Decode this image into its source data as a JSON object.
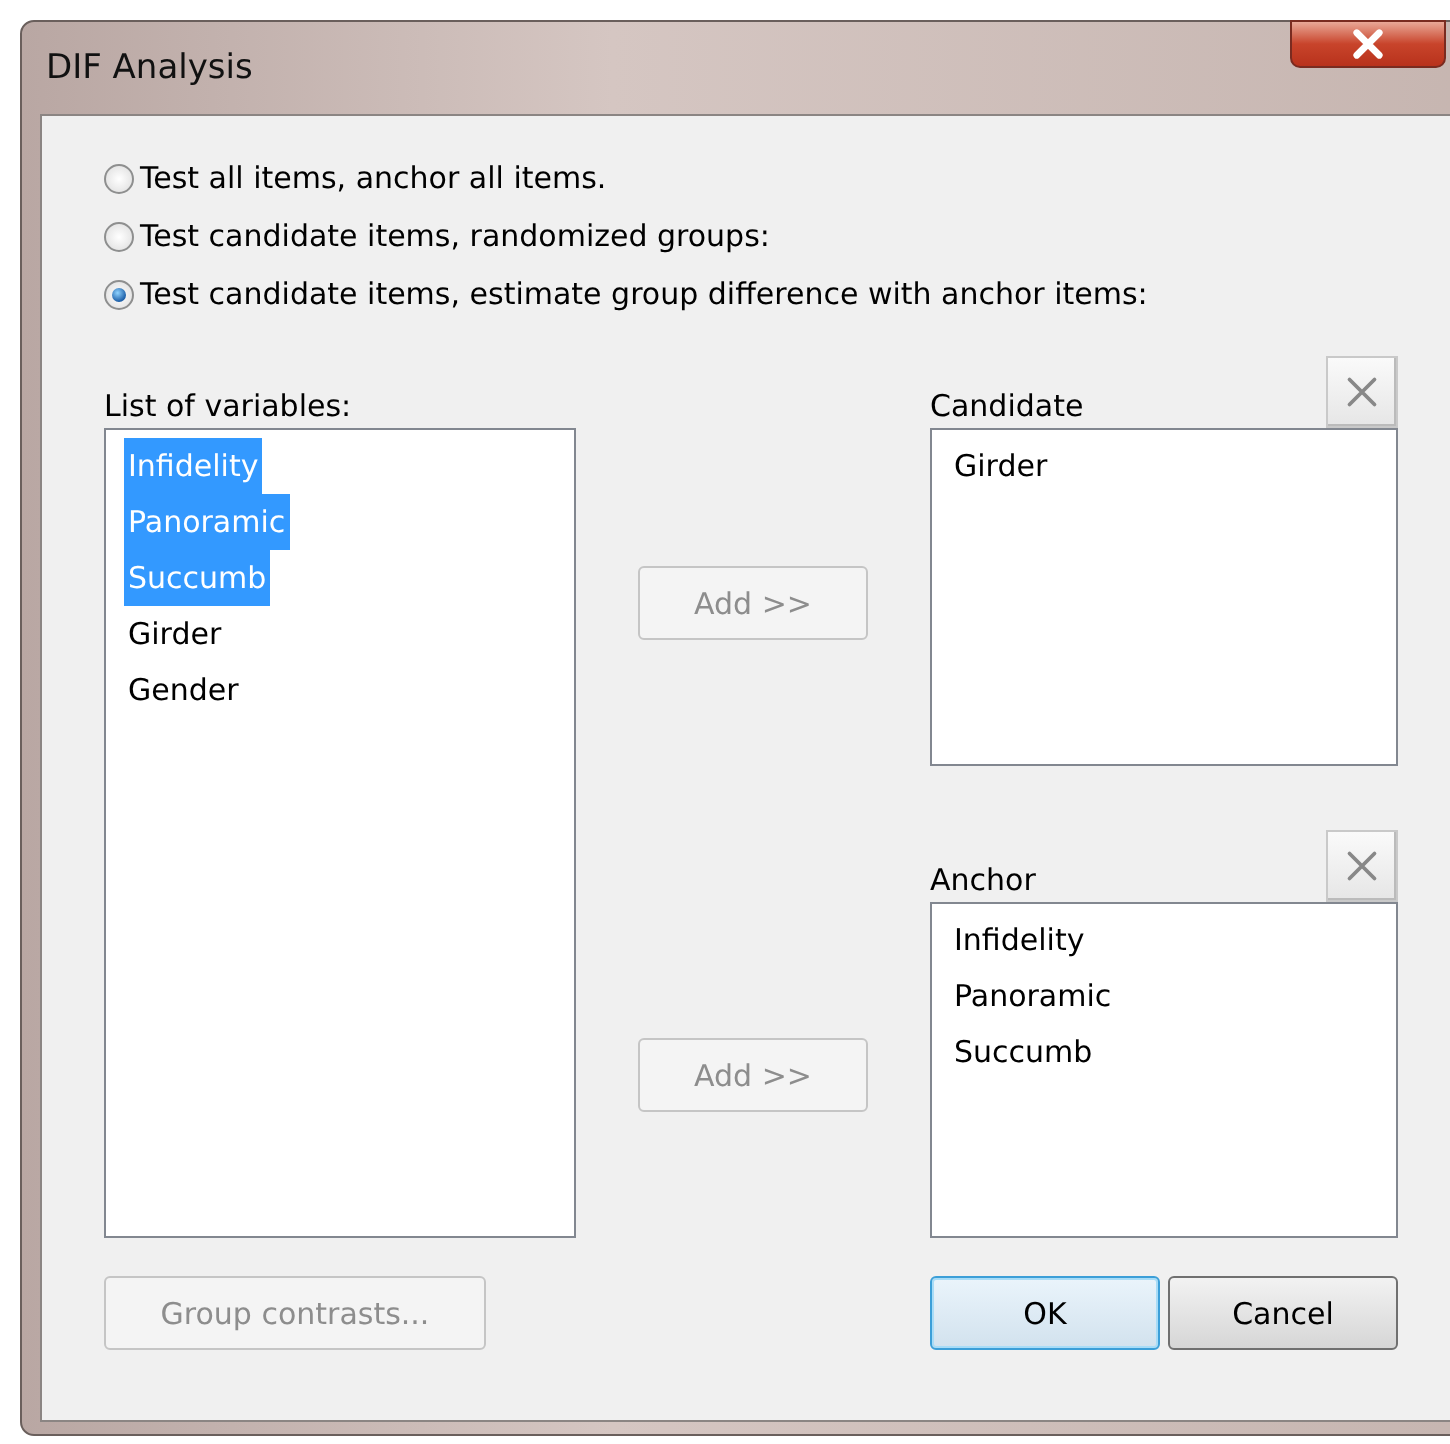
{
  "window": {
    "title": "DIF Analysis"
  },
  "options": [
    {
      "label": "Test all items, anchor all items.",
      "selected": false
    },
    {
      "label": "Test candidate items, randomized groups:",
      "selected": false
    },
    {
      "label": "Test candidate items, estimate group difference with anchor items:",
      "selected": true
    }
  ],
  "variables": {
    "label": "List of variables:",
    "items": [
      {
        "label": "Infidelity",
        "selected": true
      },
      {
        "label": "Panoramic",
        "selected": true
      },
      {
        "label": "Succumb",
        "selected": true
      },
      {
        "label": "Girder",
        "selected": false
      },
      {
        "label": "Gender",
        "selected": false
      }
    ]
  },
  "candidate": {
    "label": "Candidate",
    "add_button": {
      "label": "Add >>",
      "disabled": true
    },
    "items": [
      {
        "label": "Girder",
        "selected": false
      }
    ]
  },
  "anchor": {
    "label": "Anchor",
    "add_button": {
      "label": "Add >>",
      "disabled": true
    },
    "items": [
      {
        "label": "Infidelity",
        "selected": false
      },
      {
        "label": "Panoramic",
        "selected": false
      },
      {
        "label": "Succumb",
        "selected": false
      }
    ]
  },
  "buttons": [
    {
      "label": "Group contrasts...",
      "disabled": true,
      "default": false
    },
    {
      "label": "OK",
      "disabled": false,
      "default": true
    },
    {
      "label": "Cancel",
      "disabled": false,
      "default": false
    }
  ]
}
